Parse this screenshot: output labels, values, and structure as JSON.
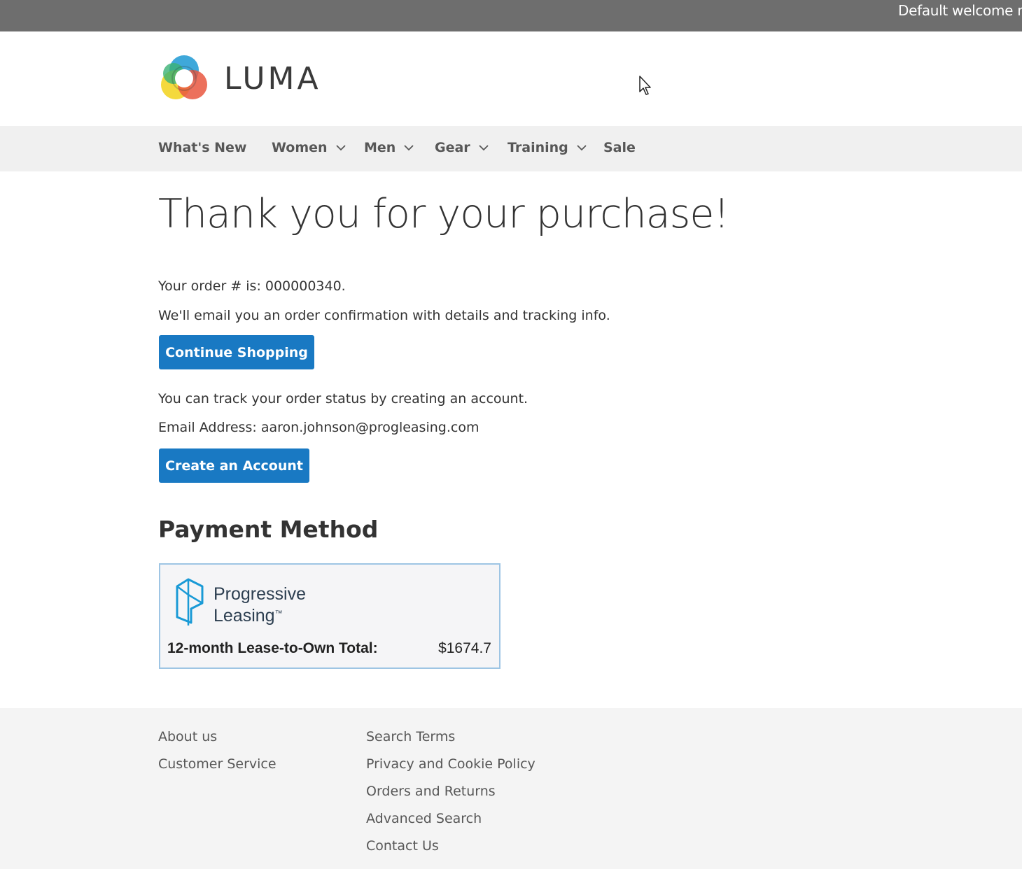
{
  "topbar": {
    "welcome": "Default welcome ms"
  },
  "header": {
    "brand": "LUMA",
    "logo_icon": "luma-logo-icon",
    "cursor_icon": "mouse-pointer-icon"
  },
  "nav": {
    "items": [
      {
        "label": "What's New",
        "has_dropdown": false
      },
      {
        "label": "Women",
        "has_dropdown": true
      },
      {
        "label": "Men",
        "has_dropdown": true
      },
      {
        "label": "Gear",
        "has_dropdown": true
      },
      {
        "label": "Training",
        "has_dropdown": true
      },
      {
        "label": "Sale",
        "has_dropdown": false
      }
    ],
    "dropdown_icon": "chevron-down-icon"
  },
  "main": {
    "title": "Thank you for your purchase!",
    "order_line": "Your order # is: 000000340.",
    "email_notice": "We'll email you an order confirmation with details and tracking info.",
    "continue_button": "Continue Shopping",
    "track_notice": "You can track your order status by creating an account.",
    "email_line": "Email Address: aaron.johnson@progleasing.com",
    "create_account_button": "Create an Account",
    "payment_title": "Payment Method",
    "payment": {
      "provider_line1": "Progressive",
      "provider_line2": "Leasing",
      "provider_tm": "™",
      "provider_icon": "progressive-leasing-logo-icon",
      "lease_label": "12-month Lease-to-Own Total:",
      "lease_value": "$1674.7"
    }
  },
  "footer": {
    "col1": [
      "About us",
      "Customer Service"
    ],
    "col2": [
      "Search Terms",
      "Privacy and Cookie Policy",
      "Orders and Returns",
      "Advanced Search",
      "Contact Us"
    ]
  },
  "colors": {
    "topbar": "#6e6e6e",
    "nav_bg": "#f0f0f0",
    "button": "#1979c3",
    "footer_bg": "#f4f4f4",
    "payment_border": "#9ec5e4"
  }
}
